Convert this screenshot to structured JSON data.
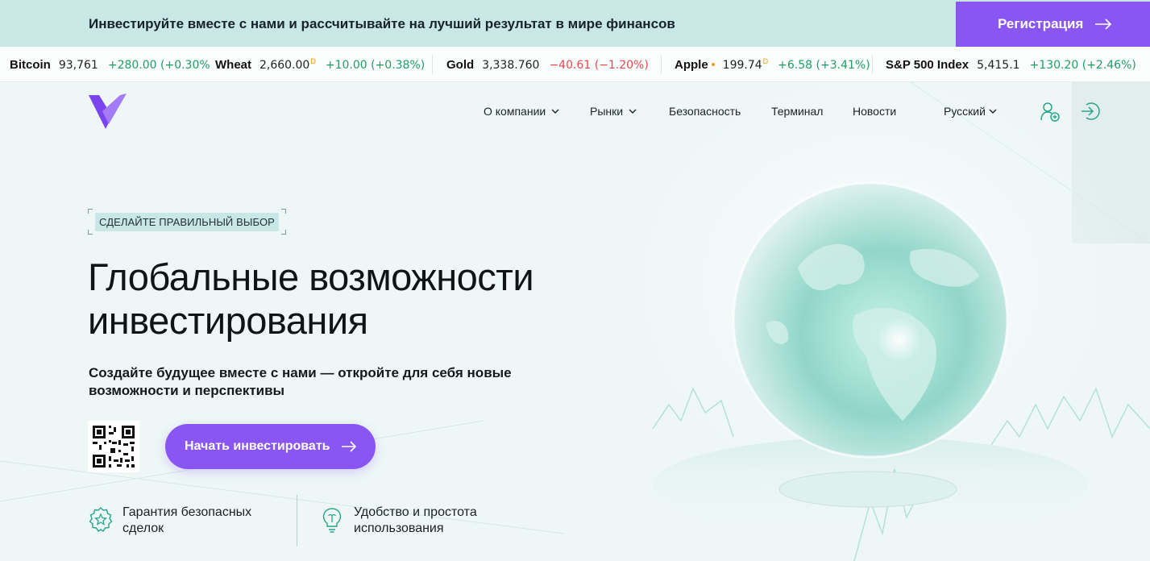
{
  "banner": {
    "text": "Инвестируйте вместе с нами и рассчитывайте на лучший результат в мире финансов",
    "register_label": "Регистрация"
  },
  "ticker": [
    {
      "symbol": "Bitcoin",
      "price": "93,761",
      "change": "+280.00 (+0.30%",
      "direction": "up"
    },
    {
      "symbol": "Wheat",
      "price": "2,660.00",
      "mark": "D",
      "change": "+10.00 (+0.38%)",
      "direction": "up"
    },
    {
      "symbol": "Gold",
      "price": "3,338.760",
      "change": "−40.61 (−1.20%)",
      "direction": "down"
    },
    {
      "symbol": "Apple",
      "price": "199.74",
      "mark": "D",
      "change": "+6.58 (+3.41%)",
      "direction": "up"
    },
    {
      "symbol": "S&P 500 Index",
      "price": "5,415.1",
      "change": "+130.20 (+2.46%)",
      "direction": "up"
    }
  ],
  "nav": {
    "items": [
      "О компании",
      "Рынки",
      "Безопасность",
      "Терминал",
      "Новости"
    ],
    "language": "Русский"
  },
  "hero": {
    "badge": "СДЕЛАЙТЕ ПРАВИЛЬНЫЙ ВЫБОР",
    "title_line1": "Глобальные возможности",
    "title_line2": "инвестирования",
    "subtitle": "Создайте будущее вместе с нами — откройте для себя новые возможности и перспективы",
    "cta_label": "Начать инвестировать"
  },
  "features": [
    {
      "text": "Гарантия безопасных сделок",
      "icon": "star-badge-icon"
    },
    {
      "text": "Удобство и простота использования",
      "icon": "lightbulb-icon"
    }
  ],
  "colors": {
    "accent": "#8a56f3",
    "banner_bg": "#c9e7e5",
    "page_bg": "#eef7f6",
    "positive": "#1f9d67",
    "negative": "#e5484d",
    "icon_teal": "#27a58a"
  }
}
